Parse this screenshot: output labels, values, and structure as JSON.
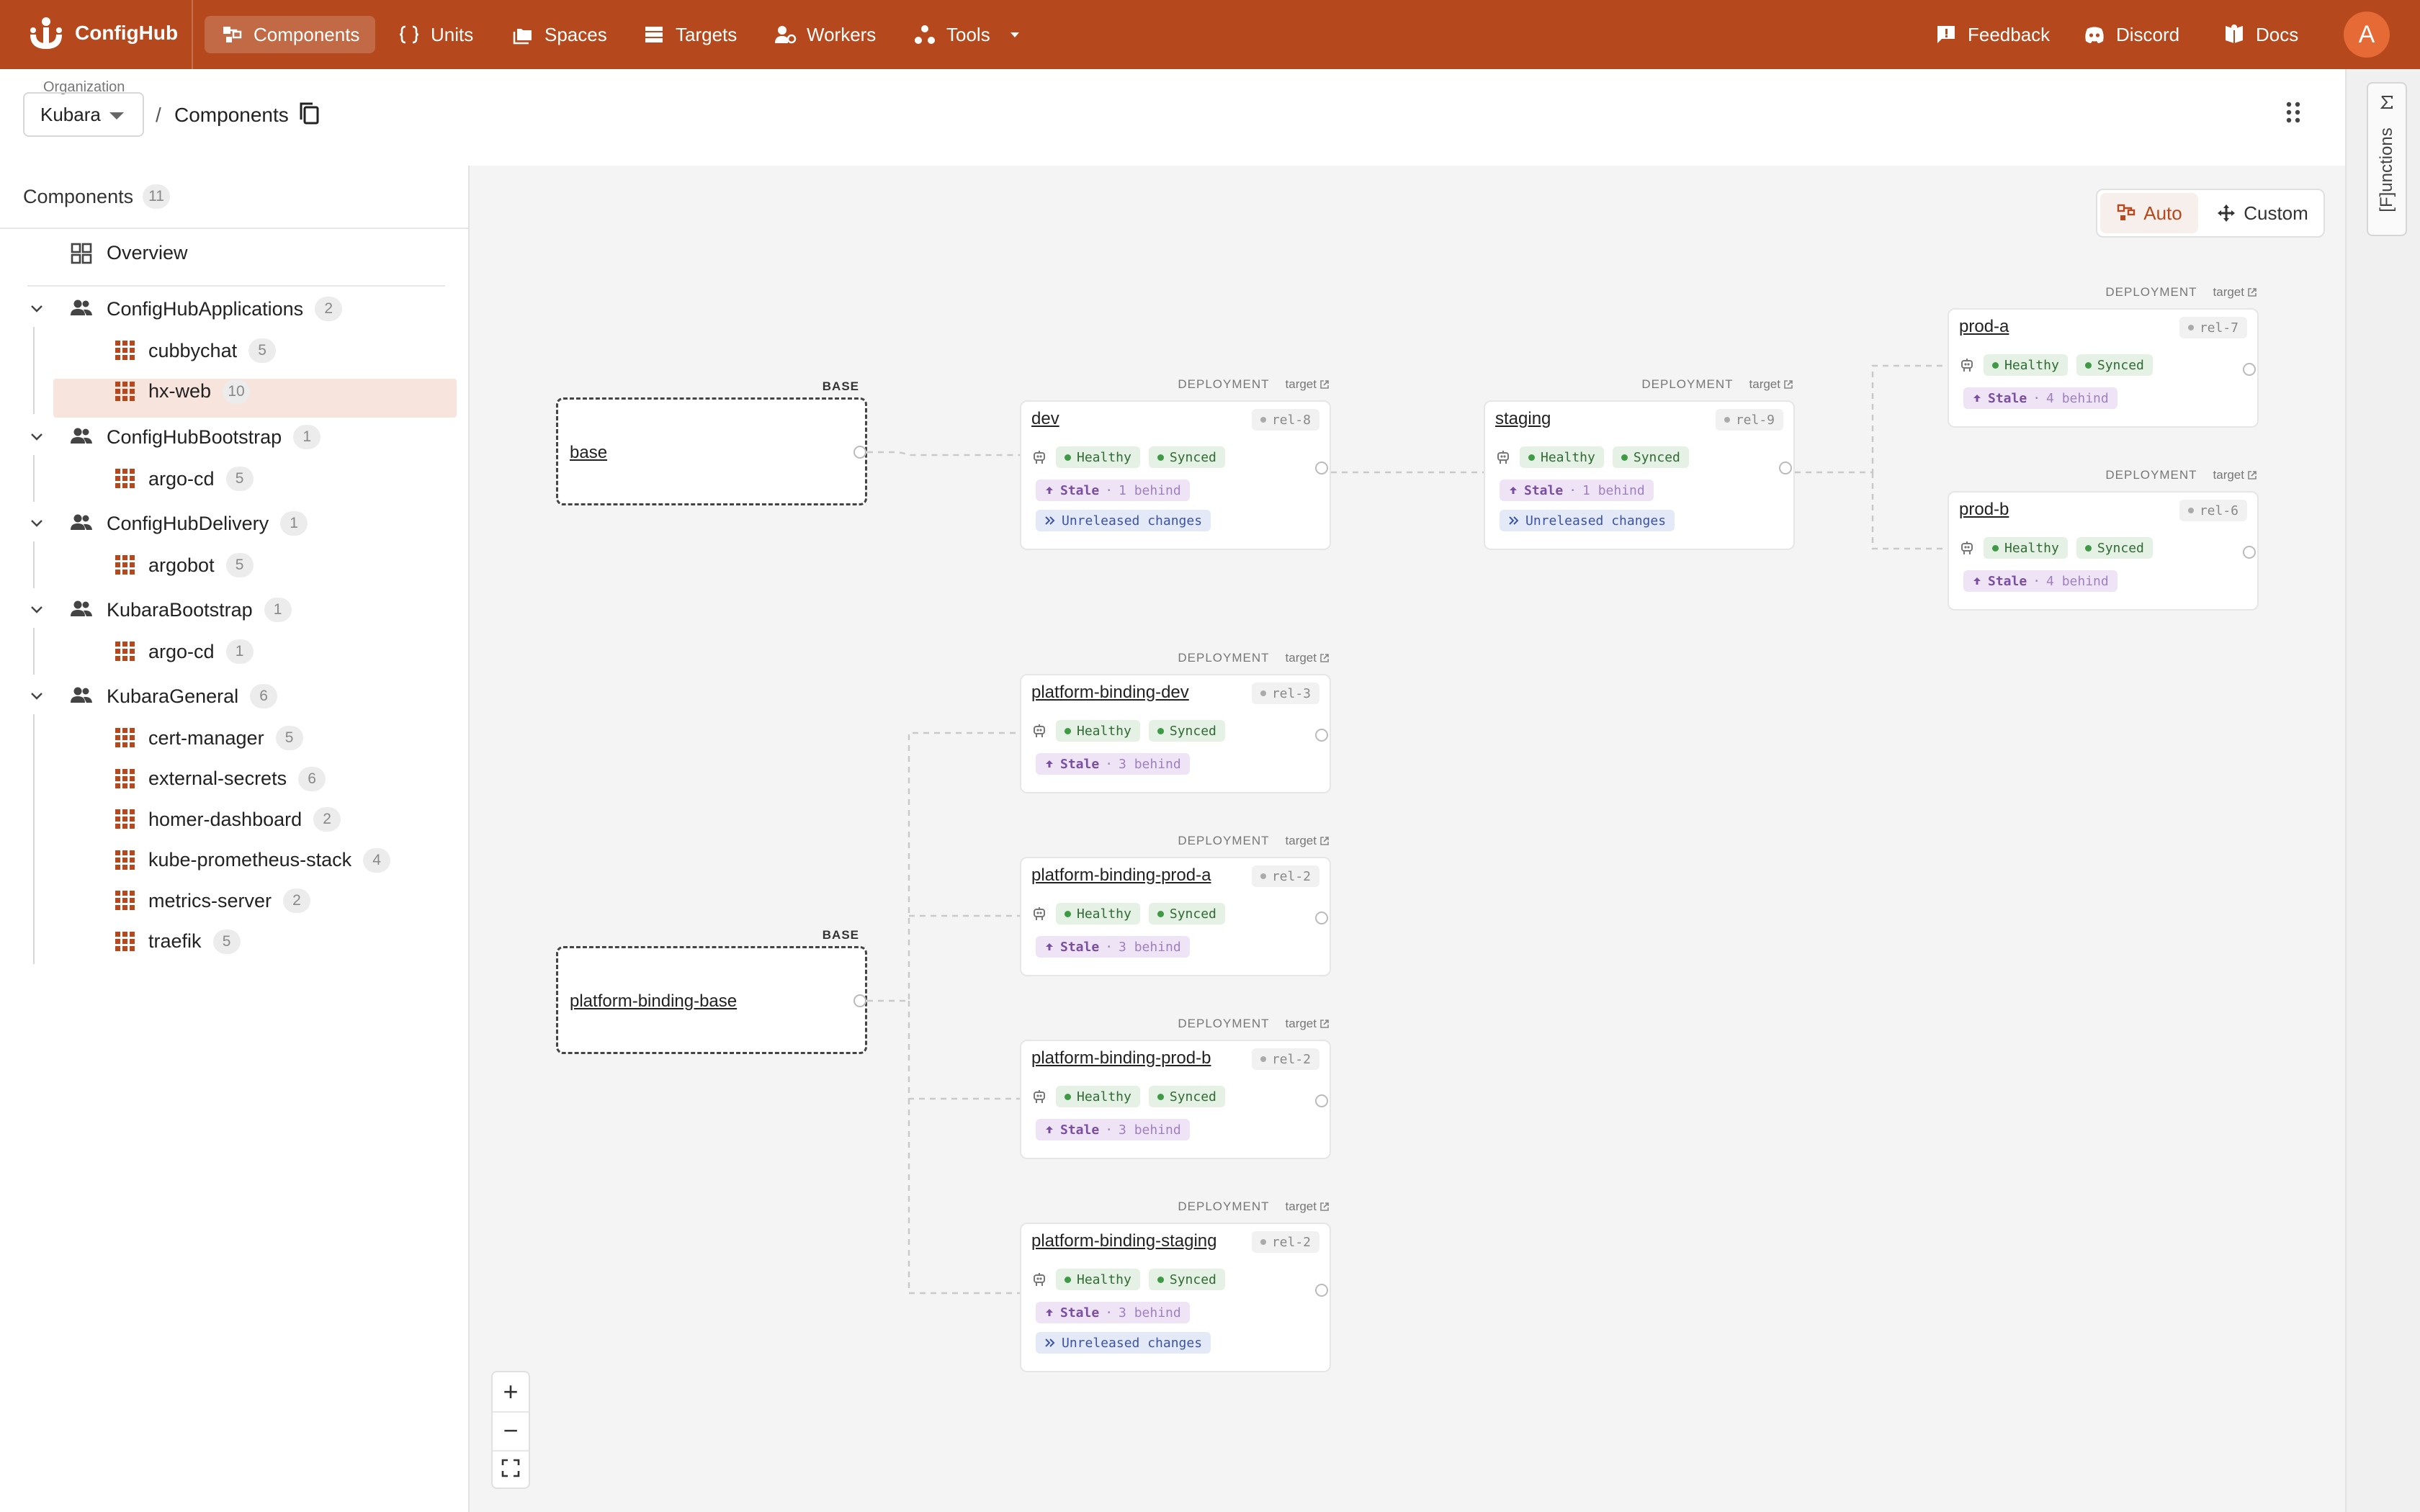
{
  "app": {
    "brand": "ConfigHub",
    "nav": [
      {
        "label": "Components",
        "icon": "components-icon",
        "active": true
      },
      {
        "label": "Units",
        "icon": "braces-icon",
        "active": false
      },
      {
        "label": "Spaces",
        "icon": "folders-icon",
        "active": false
      },
      {
        "label": "Targets",
        "icon": "server-icon",
        "active": false
      },
      {
        "label": "Workers",
        "icon": "workers-icon",
        "active": false
      },
      {
        "label": "Tools",
        "icon": "tools-icon",
        "active": false
      }
    ],
    "right_nav": [
      {
        "label": "Feedback",
        "icon": "feedback-icon"
      },
      {
        "label": "Discord",
        "icon": "discord-icon"
      },
      {
        "label": "Docs",
        "icon": "docs-icon"
      }
    ],
    "avatar": "A",
    "accent": "#b5481d"
  },
  "breadcrumb": {
    "org_label": "Organization",
    "org": "Kubara",
    "separator": "/",
    "current": "Components"
  },
  "functions_tab": {
    "label": "[F]unctions",
    "icon": "sigma-icon"
  },
  "sidebar": {
    "title": "Components",
    "count": "11",
    "overview": "Overview",
    "groups": [
      {
        "name": "ConfigHubApplications",
        "count": "2",
        "items": [
          {
            "name": "cubbychat",
            "count": "5"
          },
          {
            "name": "hx-web",
            "count": "10",
            "selected": true
          }
        ]
      },
      {
        "name": "ConfigHubBootstrap",
        "count": "1",
        "items": [
          {
            "name": "argo-cd",
            "count": "5"
          }
        ]
      },
      {
        "name": "ConfigHubDelivery",
        "count": "1",
        "items": [
          {
            "name": "argobot",
            "count": "5"
          }
        ]
      },
      {
        "name": "KubaraBootstrap",
        "count": "1",
        "items": [
          {
            "name": "argo-cd",
            "count": "1"
          }
        ]
      },
      {
        "name": "KubaraGeneral",
        "count": "6",
        "items": [
          {
            "name": "cert-manager",
            "count": "5"
          },
          {
            "name": "external-secrets",
            "count": "6"
          },
          {
            "name": "homer-dashboard",
            "count": "2"
          },
          {
            "name": "kube-prometheus-stack",
            "count": "4"
          },
          {
            "name": "metrics-server",
            "count": "2"
          },
          {
            "name": "traefik",
            "count": "5"
          }
        ]
      }
    ]
  },
  "layout_toggle": {
    "auto": "Auto",
    "custom": "Custom"
  },
  "graph": {
    "base_tag": "BASE",
    "deploy_tag": "DEPLOYMENT",
    "target_link": "target",
    "bases": [
      "base",
      "platform-binding-base"
    ],
    "deployments": [
      {
        "name": "dev",
        "rel": "rel-8",
        "health": "Healthy",
        "sync": "Synced",
        "stale": "Stale",
        "behind": "1 behind",
        "unreleased": "Unreleased changes"
      },
      {
        "name": "staging",
        "rel": "rel-9",
        "health": "Healthy",
        "sync": "Synced",
        "stale": "Stale",
        "behind": "1 behind",
        "unreleased": "Unreleased changes"
      },
      {
        "name": "prod-a",
        "rel": "rel-7",
        "health": "Healthy",
        "sync": "Synced",
        "stale": "Stale",
        "behind": "4 behind"
      },
      {
        "name": "prod-b",
        "rel": "rel-6",
        "health": "Healthy",
        "sync": "Synced",
        "stale": "Stale",
        "behind": "4 behind"
      },
      {
        "name": "platform-binding-dev",
        "rel": "rel-3",
        "health": "Healthy",
        "sync": "Synced",
        "stale": "Stale",
        "behind": "3 behind"
      },
      {
        "name": "platform-binding-prod-a",
        "rel": "rel-2",
        "health": "Healthy",
        "sync": "Synced",
        "stale": "Stale",
        "behind": "3 behind"
      },
      {
        "name": "platform-binding-prod-b",
        "rel": "rel-2",
        "health": "Healthy",
        "sync": "Synced",
        "stale": "Stale",
        "behind": "3 behind"
      },
      {
        "name": "platform-binding-staging",
        "rel": "rel-2",
        "health": "Healthy",
        "sync": "Synced",
        "stale": "Stale",
        "behind": "3 behind",
        "unreleased": "Unreleased changes"
      }
    ]
  },
  "zoom": {
    "in": "+",
    "out": "−"
  }
}
